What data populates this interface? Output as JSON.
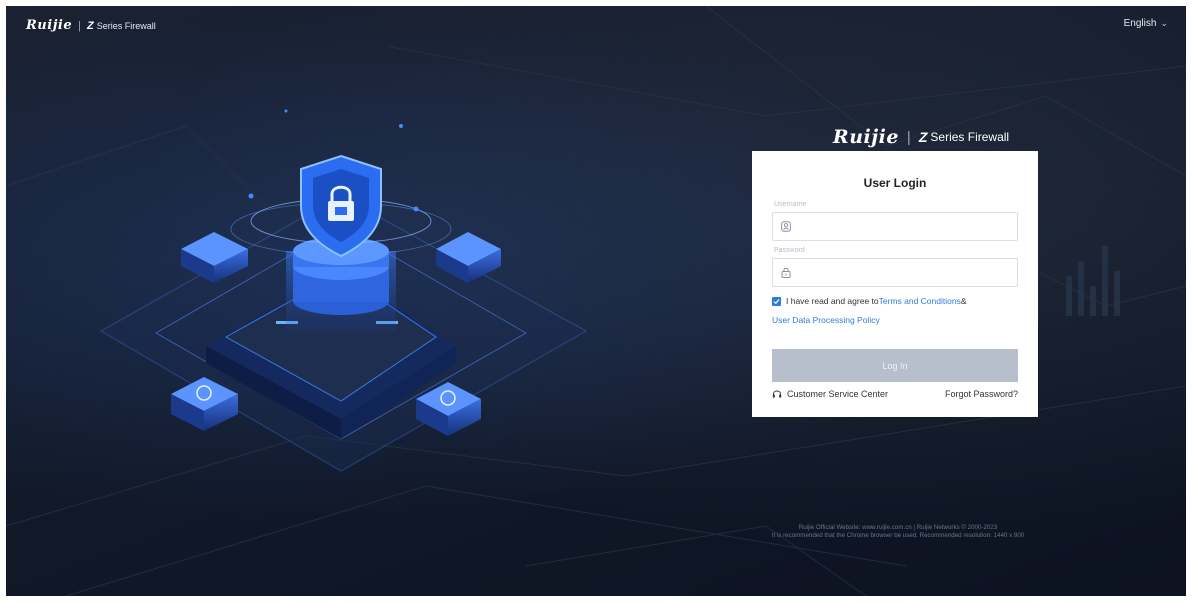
{
  "header": {
    "brand_logo": "Ruijie",
    "brand_product_mark": "Z",
    "brand_product_name": "Series Firewall",
    "language": "English"
  },
  "login": {
    "brand_logo": "Ruijie",
    "brand_product_mark": "Z",
    "brand_product_name": "Series Firewall",
    "title": "User Login",
    "username_label": "Username",
    "username_value": "",
    "password_label": "Password",
    "password_value": "",
    "agree_checked": true,
    "agree_prefix": "I have read and agree to",
    "terms_link": "Terms and Conditions",
    "agree_connector": "&",
    "policy_link": "User Data Processing Policy",
    "login_button": "Log In",
    "service_link": "Customer Service Center",
    "forgot_link": "Forgot Password?"
  },
  "footer": {
    "line1": "Ruijie Official Website: www.ruijie.com.cn | Ruijie Networks © 2000-2023",
    "line2": "It is recommended that the Chrome browser be used. Recommended resolution: 1440 x 900"
  },
  "colors": {
    "accent": "#2f7bd9",
    "button_disabled": "#b7bfcc",
    "background": "#121a2a"
  },
  "icons": [
    "chevron-down-icon",
    "user-icon",
    "lock-icon",
    "checkbox-checked-icon",
    "headset-icon",
    "security-shield-illustration"
  ]
}
